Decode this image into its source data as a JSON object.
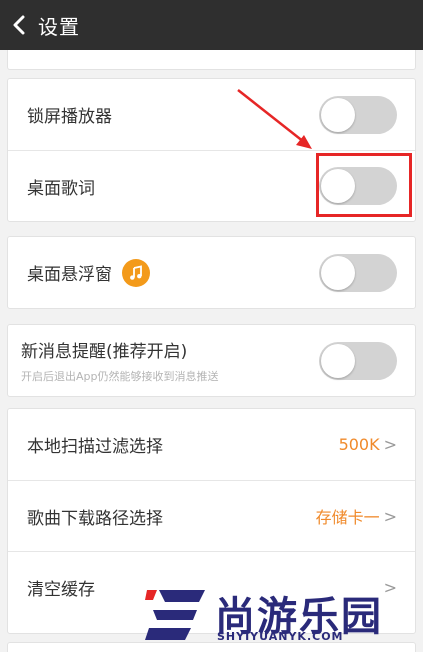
{
  "header": {
    "title": "设置"
  },
  "settings": {
    "lockscreen_player": "锁屏播放器",
    "desktop_lyrics": "桌面歌词",
    "desktop_float_window": "桌面悬浮窗",
    "new_message_title": "新消息提醒(推荐开启)",
    "new_message_sub": "开启后退出App仍然能够接收到消息推送",
    "local_scan_filter": "本地扫描过滤选择",
    "local_scan_value": "500K",
    "download_path": "歌曲下载路径选择",
    "download_path_value": "存储卡一",
    "clear_cache": "清空缓存"
  },
  "toggles": {
    "lockscreen_player": false,
    "desktop_lyrics": false,
    "desktop_float_window": false,
    "new_message": false
  },
  "watermark": {
    "brand": "尚游乐园",
    "url": "SHYIYUANYK.COM"
  },
  "colors": {
    "header_bg": "#2f2f2f",
    "accent": "#f08a2b",
    "highlight": "#e62626"
  }
}
